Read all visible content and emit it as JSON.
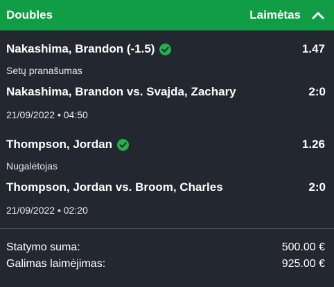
{
  "header": {
    "title": "Doubles",
    "status": "Laimėtas",
    "icon": "chevron-up-icon"
  },
  "bets": [
    {
      "selection": "Nakashima, Brandon (-1.5)",
      "odds": "1.47",
      "status_icon": "check-circle-icon",
      "market": "Setų pranašumas",
      "event": "Nakashima, Brandon vs. Svajda, Zachary",
      "score": "2:0",
      "datetime": "21/09/2022 • 04:50"
    },
    {
      "selection": "Thompson, Jordan",
      "odds": "1.26",
      "status_icon": "check-circle-icon",
      "market": "Nugalėtojas",
      "event": "Thompson, Jordan vs. Broom, Charles",
      "score": "2:0",
      "datetime": "21/09/2022 • 02:20"
    }
  ],
  "summary": {
    "stake_label": "Statymo suma:",
    "stake_value": "500.00 €",
    "winnings_label": "Galimas laimėjimas:",
    "winnings_value": "925.00 €"
  },
  "colors": {
    "header_bg": "#109d46",
    "body_bg": "#232830",
    "check_green": "#22b14c"
  }
}
